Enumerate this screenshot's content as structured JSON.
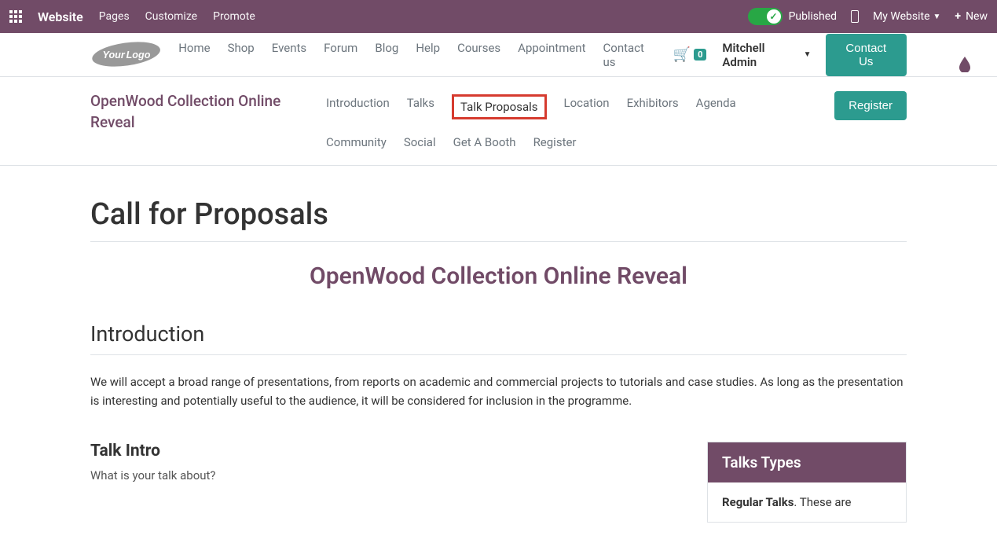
{
  "topbar": {
    "app_name": "Website",
    "links": [
      "Pages",
      "Customize",
      "Promote"
    ],
    "published_label": "Published",
    "my_website_label": "My Website",
    "new_label": "New"
  },
  "main_nav": {
    "links": [
      "Home",
      "Shop",
      "Events",
      "Forum",
      "Blog",
      "Help",
      "Courses",
      "Appointment",
      "Contact us"
    ],
    "cart_count": "0",
    "user_name": "Mitchell Admin",
    "contact_label": "Contact Us"
  },
  "event_nav": {
    "title": "OpenWood Collection Online Reveal",
    "tabs": [
      "Introduction",
      "Talks",
      "Talk Proposals",
      "Location",
      "Exhibitors",
      "Agenda",
      "Community",
      "Social",
      "Get A Booth",
      "Register"
    ],
    "active_tab": "Talk Proposals",
    "register_label": "Register"
  },
  "content": {
    "page_title": "Call for Proposals",
    "event_subtitle": "OpenWood Collection Online Reveal",
    "intro_title": "Introduction",
    "intro_text": "We will accept a broad range of presentations, from reports on academic and commercial projects to tutorials and case studies. As long as the presentation is interesting and potentially useful to the audience, it will be considered for inclusion in the programme.",
    "talk_intro_title": "Talk Intro",
    "talk_intro_text": "What is your talk about?",
    "sidebar_title": "Talks Types",
    "sidebar_body_bold": "Regular Talks",
    "sidebar_body_rest": ". These are"
  }
}
